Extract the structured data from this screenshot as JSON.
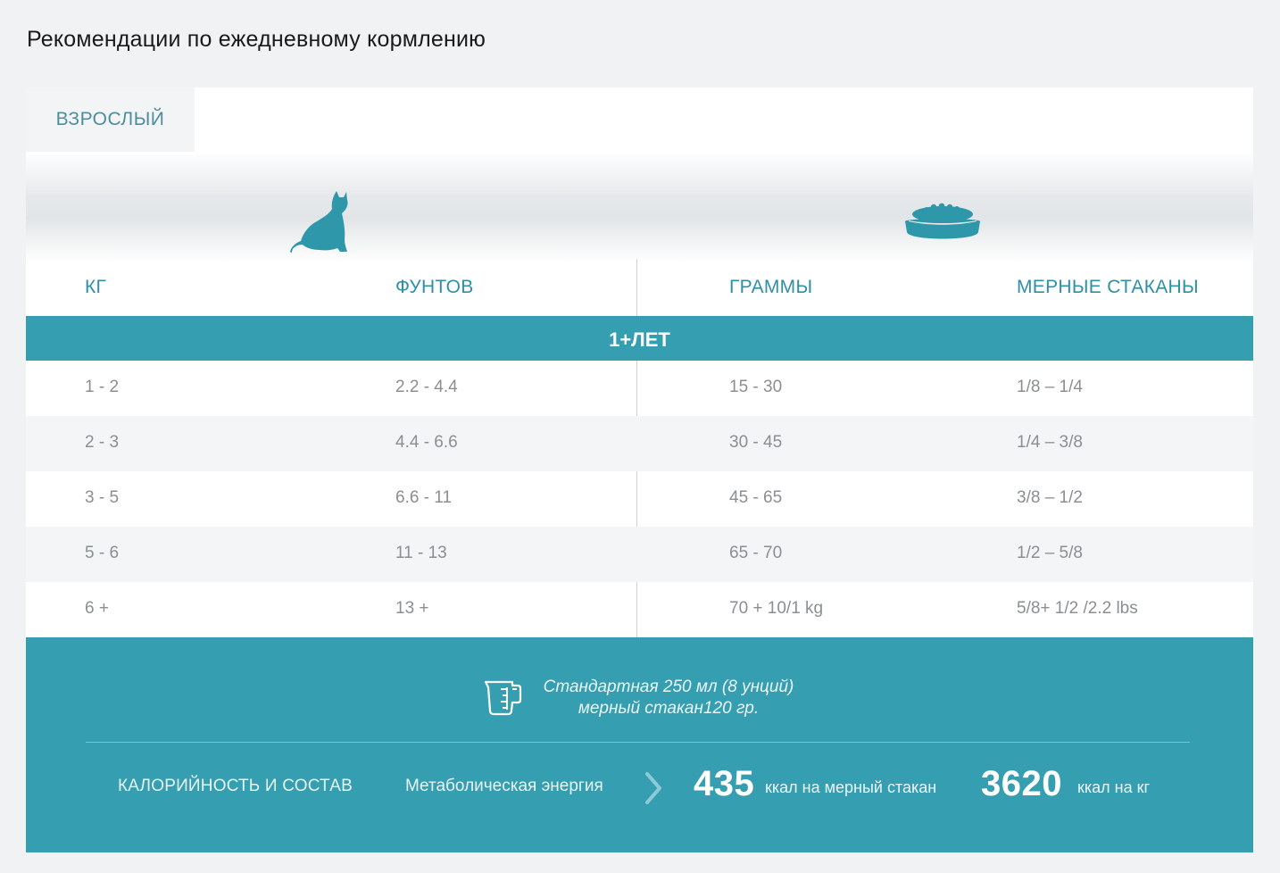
{
  "page": {
    "title": "Рекомендации по ежедневному кормлению"
  },
  "tabs": [
    {
      "label": "ВЗРОСЛЫЙ",
      "active": true
    }
  ],
  "icons": {
    "cat": "cat-icon",
    "bowl": "food-bowl-icon",
    "cup": "measuring-cup-icon",
    "chevron": "chevron-right-icon"
  },
  "table": {
    "headers": [
      "КГ",
      "ФУНТОВ",
      "ГРАММЫ",
      "МЕРНЫЕ СТАКАНЫ"
    ],
    "age_group": "1+ЛЕТ",
    "rows": [
      [
        "1 - 2",
        "2.2 - 4.4",
        "15 - 30",
        "1/8 – 1/4"
      ],
      [
        "2 - 3",
        "4.4 - 6.6",
        "30 - 45",
        "1/4 – 3/8"
      ],
      [
        "3 - 5",
        "6.6 - 11",
        "45 - 65",
        "3/8 – 1/2"
      ],
      [
        "5 - 6",
        "11 - 13",
        "65 - 70",
        "1/2 – 5/8"
      ],
      [
        "6 +",
        "13 +",
        "70 + 10/1 kg",
        "5/8+ 1/2 /2.2 lbs"
      ]
    ]
  },
  "footer": {
    "cup_note_line1": "Стандартная 250 мл (8 унций)",
    "cup_note_line2": "мерный стакан120 гр.",
    "calorie_label": "КАЛОРИЙНОСТЬ И СОСТАВ",
    "energy_label": "Метаболическая энергия",
    "kcal_per_cup_value": "435",
    "kcal_per_cup_unit": "ккал на мерный стакан",
    "kcal_per_kg_value": "3620",
    "kcal_per_kg_unit": "ккал на кг"
  },
  "colors": {
    "accent": "#359eb0",
    "header_text": "#2f8fa6",
    "cell_text": "#8a8f93",
    "tab_text": "#4f8c9d",
    "page_bg": "#f1f2f3"
  }
}
